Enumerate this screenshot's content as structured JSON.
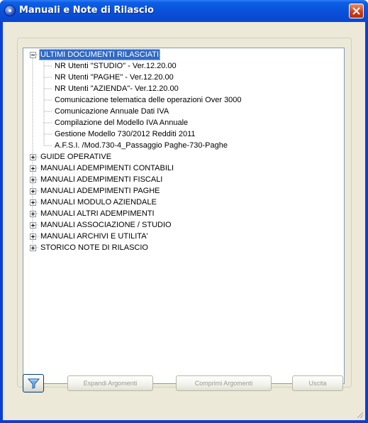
{
  "window": {
    "title": "Manuali e Note di Rilascio",
    "icons": {
      "app": "app-globe-icon",
      "close": "close-icon"
    }
  },
  "tree": {
    "root_nodes": [
      {
        "label": "ULTIMI DOCUMENTI RILASCIATI",
        "expanded": true,
        "selected": true,
        "children": [
          "NR Utenti \"STUDIO\" - Ver.12.20.00",
          "NR Utenti \"PAGHE\"  - Ver.12.20.00",
          "NR Utenti \"AZIENDA\"- Ver.12.20.00",
          "Comunicazione telematica delle operazioni Over 3000",
          "Comunicazione Annuale Dati IVA",
          "Compilazione del Modello IVA Annuale",
          "Gestione Modello 730/2012 Redditi 2011",
          "A.F.S.I. /Mod.730-4_Passaggio Paghe-730-Paghe"
        ]
      },
      {
        "label": "GUIDE OPERATIVE",
        "expanded": false
      },
      {
        "label": "MANUALI ADEMPIMENTI CONTABILI",
        "expanded": false
      },
      {
        "label": "MANUALI ADEMPIMENTI FISCALI",
        "expanded": false
      },
      {
        "label": "MANUALI ADEMPIMENTI PAGHE",
        "expanded": false
      },
      {
        "label": "MANUALI MODULO AZIENDALE",
        "expanded": false
      },
      {
        "label": "MANUALI ALTRI ADEMPIMENTI",
        "expanded": false
      },
      {
        "label": "MANUALI ASSOCIAZIONE / STUDIO",
        "expanded": false
      },
      {
        "label": "MANUALI ARCHIVI E UTILITA'",
        "expanded": false
      },
      {
        "label": "STORICO NOTE DI RILASCIO",
        "expanded": false
      }
    ]
  },
  "buttons": {
    "filter_icon": "funnel-icon",
    "expand": "Espandi Argomenti",
    "collapse": "Comprimi Argomenti",
    "exit": "Uscita"
  },
  "colors": {
    "titlebar": "#0a4fd9",
    "window_face": "#ece9d8",
    "selection": "#316ac5",
    "tree_border": "#7f9db9"
  }
}
